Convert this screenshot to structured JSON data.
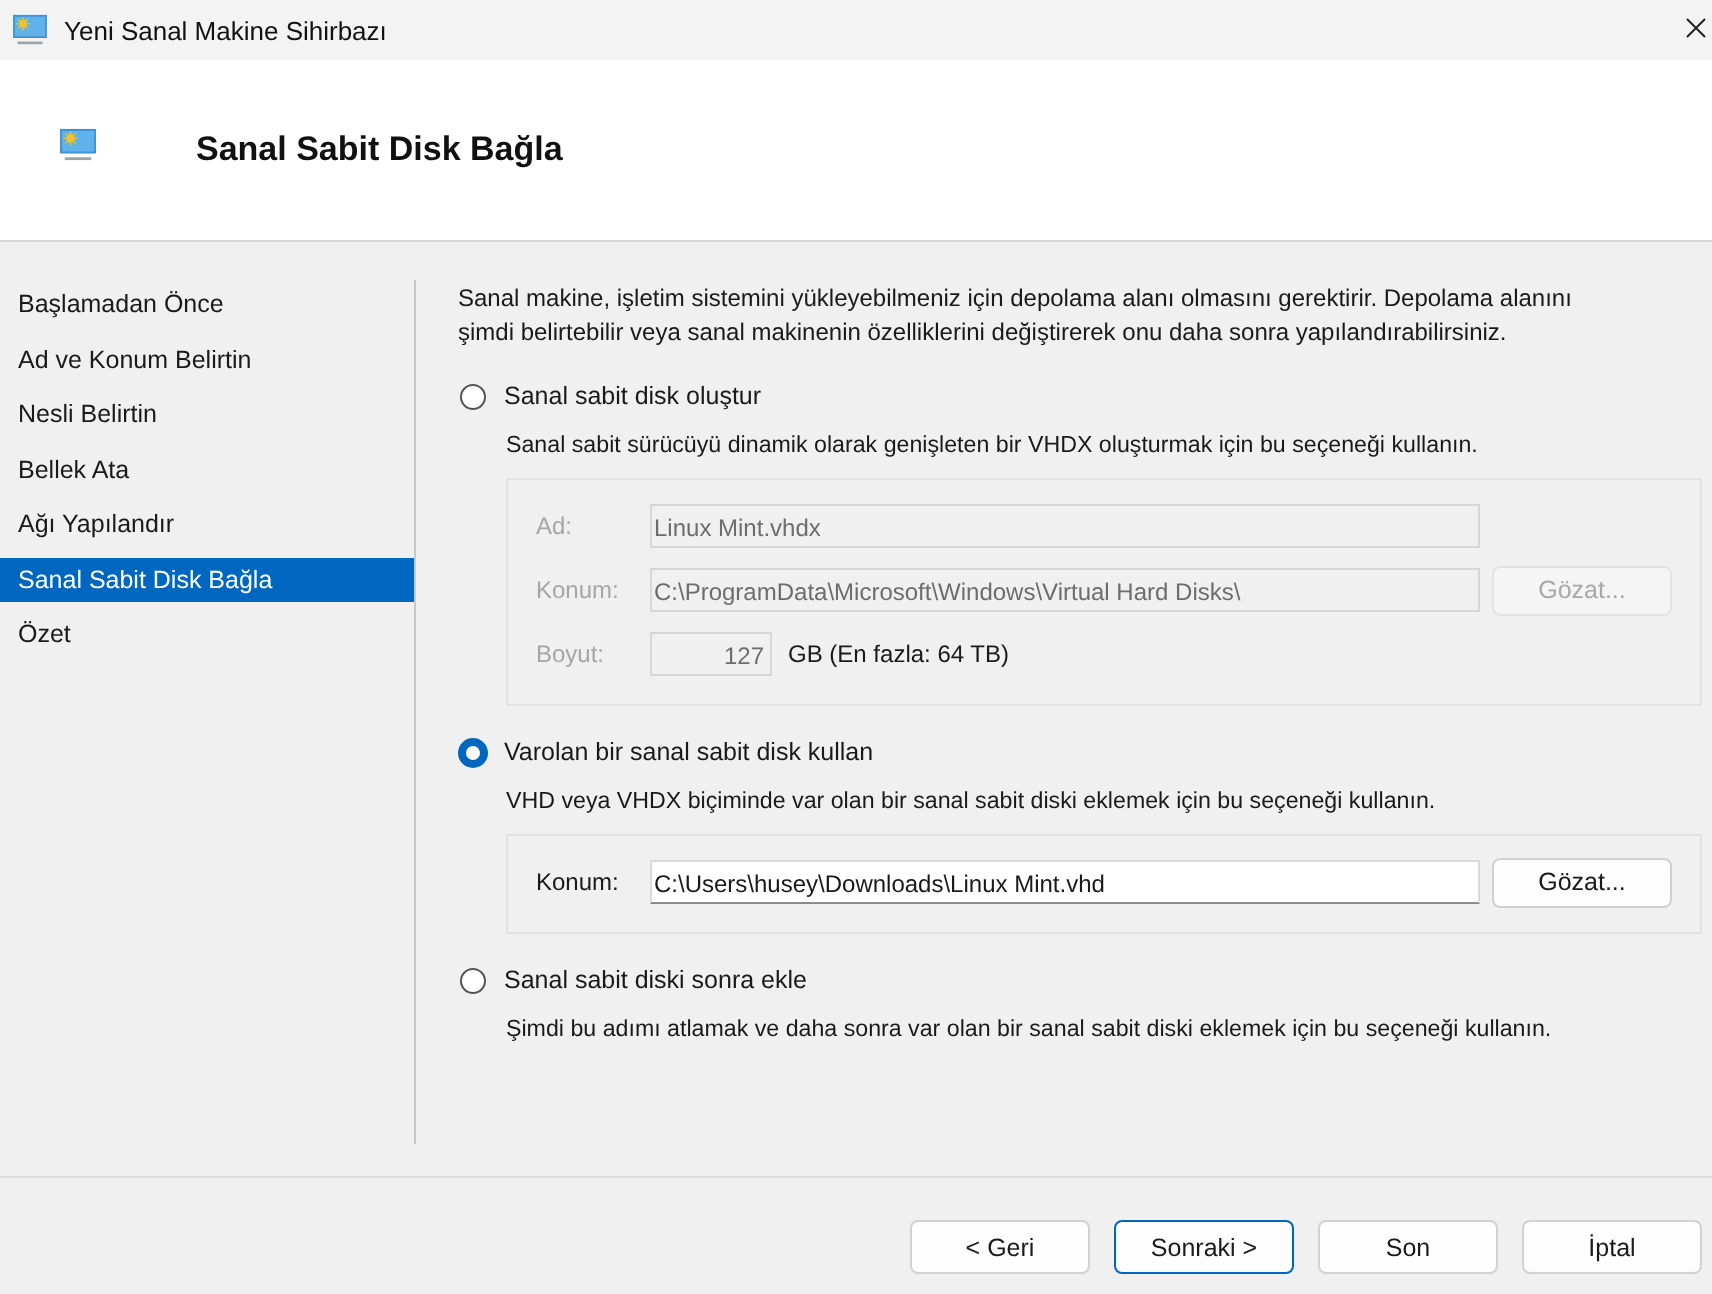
{
  "window": {
    "title": "Yeni Sanal Makine Sihirbazı"
  },
  "header": {
    "title": "Sanal Sabit Disk Bağla"
  },
  "sidebar": {
    "items": [
      {
        "label": "Başlamadan Önce",
        "selected": false
      },
      {
        "label": "Ad ve Konum Belirtin",
        "selected": false
      },
      {
        "label": "Nesli Belirtin",
        "selected": false
      },
      {
        "label": "Bellek Ata",
        "selected": false
      },
      {
        "label": "Ağı Yapılandır",
        "selected": false
      },
      {
        "label": "Sanal Sabit Disk Bağla",
        "selected": true
      },
      {
        "label": "Özet",
        "selected": false
      }
    ]
  },
  "intro": "Sanal makine, işletim sistemini yükleyebilmeniz için depolama alanı olmasını gerektirir. Depolama alanını şimdi belirtebilir veya sanal makinenin özelliklerini değiştirerek onu daha sonra yapılandırabilirsiniz.",
  "options": [
    {
      "label": "Sanal sabit disk oluştur",
      "selected": false,
      "description": "Sanal sabit sürücüyü dinamik olarak genişleten bir VHDX oluşturmak için bu seçeneği kullanın.",
      "panel": {
        "disabled": true,
        "fields": [
          {
            "kind": "text",
            "label": "Ad:",
            "value": "Linux Mint.vhdx"
          },
          {
            "kind": "path",
            "label": "Konum:",
            "value": "C:\\ProgramData\\Microsoft\\Windows\\Virtual Hard Disks\\",
            "button": "Gözat..."
          },
          {
            "kind": "size",
            "label": "Boyut:",
            "value": "127",
            "unit": "GB (En fazla: 64 TB)"
          }
        ]
      }
    },
    {
      "label": "Varolan bir sanal sabit disk kullan",
      "selected": true,
      "description": "VHD veya VHDX biçiminde var olan bir sanal sabit diski eklemek için bu seçeneği kullanın.",
      "panel": {
        "disabled": false,
        "fields": [
          {
            "kind": "path",
            "label": "Konum:",
            "value": "C:\\Users\\husey\\Downloads\\Linux Mint.vhd",
            "button": "Gözat..."
          }
        ]
      }
    },
    {
      "label": "Sanal sabit diski sonra ekle",
      "selected": false,
      "description": "Şimdi bu adımı atlamak ve daha sonra var olan bir sanal sabit diski eklemek için bu seçeneği kullanın."
    }
  ],
  "buttons": [
    {
      "label": "< Geri",
      "focused": false
    },
    {
      "label": "Sonraki >",
      "focused": true
    },
    {
      "label": "Son",
      "focused": false
    },
    {
      "label": "İptal",
      "focused": false
    }
  ]
}
